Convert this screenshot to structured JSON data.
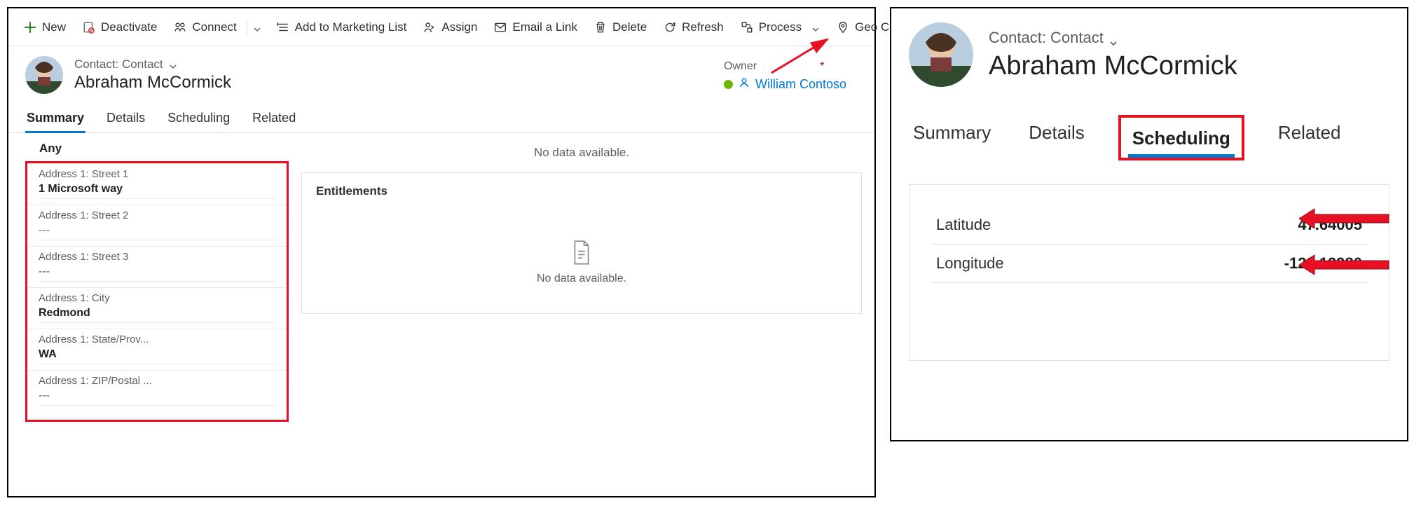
{
  "commands": {
    "new": "New",
    "deactivate": "Deactivate",
    "connect": "Connect",
    "addToMarketing": "Add to Marketing List",
    "assign": "Assign",
    "emailLink": "Email a Link",
    "delete": "Delete",
    "refresh": "Refresh",
    "process": "Process",
    "geoCode": "Geo Code"
  },
  "header": {
    "entityLabel": "Contact: Contact",
    "name": "Abraham McCormick",
    "ownerLabel": "Owner",
    "ownerName": "William Contoso"
  },
  "tabsLeft": {
    "summary": "Summary",
    "details": "Details",
    "scheduling": "Scheduling",
    "related": "Related"
  },
  "form": {
    "section": "Any",
    "street1": {
      "label": "Address 1: Street 1",
      "value": "1 Microsoft way"
    },
    "street2": {
      "label": "Address 1: Street 2",
      "value": "---"
    },
    "street3": {
      "label": "Address 1: Street 3",
      "value": "---"
    },
    "city": {
      "label": "Address 1: City",
      "value": "Redmond"
    },
    "state": {
      "label": "Address 1: State/Prov...",
      "value": "WA"
    },
    "zip": {
      "label": "Address 1: ZIP/Postal ...",
      "value": "---"
    }
  },
  "side": {
    "noDataTop": "No data available.",
    "entTitle": "Entitlements",
    "entEmpty": "No data available."
  },
  "right": {
    "entityLabel": "Contact: Contact",
    "name": "Abraham McCormick",
    "tabs": {
      "summary": "Summary",
      "details": "Details",
      "scheduling": "Scheduling",
      "related": "Related"
    },
    "lat": {
      "label": "Latitude",
      "value": "47.64005"
    },
    "lon": {
      "label": "Longitude",
      "value": "-122.12980"
    }
  }
}
